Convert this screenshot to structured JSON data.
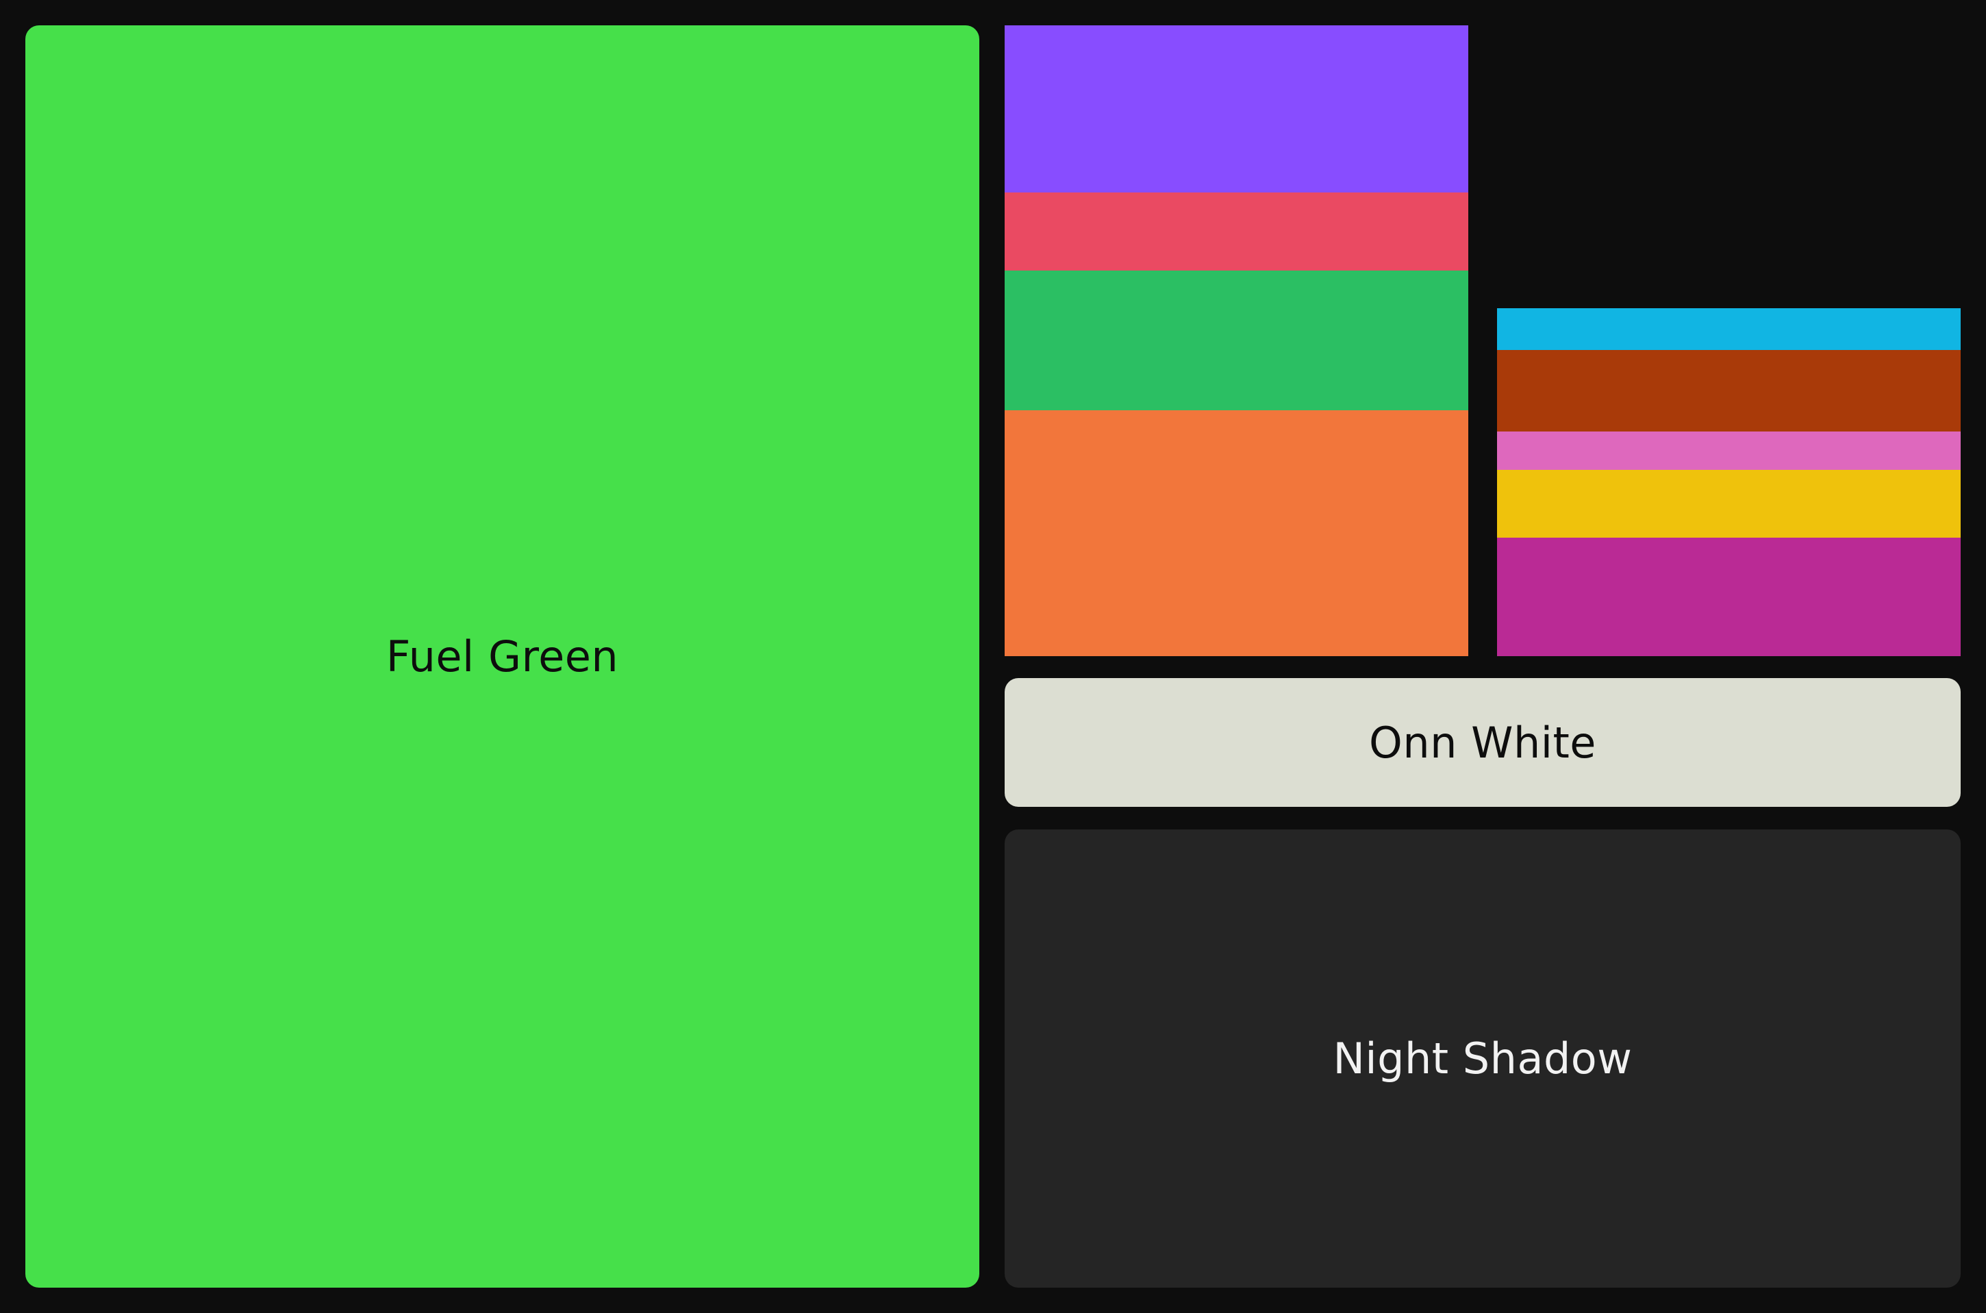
{
  "swatches": {
    "fuel_green": {
      "label": "Fuel Green",
      "color": "#46e04a",
      "text_color": "#0d0d0d"
    },
    "onn_white": {
      "label": "Onn White",
      "color": "#dcded2",
      "text_color": "#0d0d0d"
    },
    "night_shadow": {
      "label": "Night Shadow",
      "color": "#252525",
      "text_color": "#f2f2f2"
    }
  },
  "accent_stack_a": [
    {
      "name": "purple",
      "color": "#884dff",
      "share": 0.265
    },
    {
      "name": "red",
      "color": "#ea4a62",
      "share": 0.124
    },
    {
      "name": "green",
      "color": "#2bbf63",
      "share": 0.221
    },
    {
      "name": "orange",
      "color": "#f2763b",
      "share": 0.39
    }
  ],
  "accent_stack_b": [
    {
      "name": "sky-blue",
      "color": "#11b5e3",
      "share": 0.12
    },
    {
      "name": "rust",
      "color": "#a93a09",
      "share": 0.235
    },
    {
      "name": "pink",
      "color": "#de68bd",
      "share": 0.11
    },
    {
      "name": "yellow",
      "color": "#efc20c",
      "share": 0.195
    },
    {
      "name": "magenta",
      "color": "#ba2a95",
      "share": 0.34
    }
  ],
  "background_color": "#0d0d0d"
}
